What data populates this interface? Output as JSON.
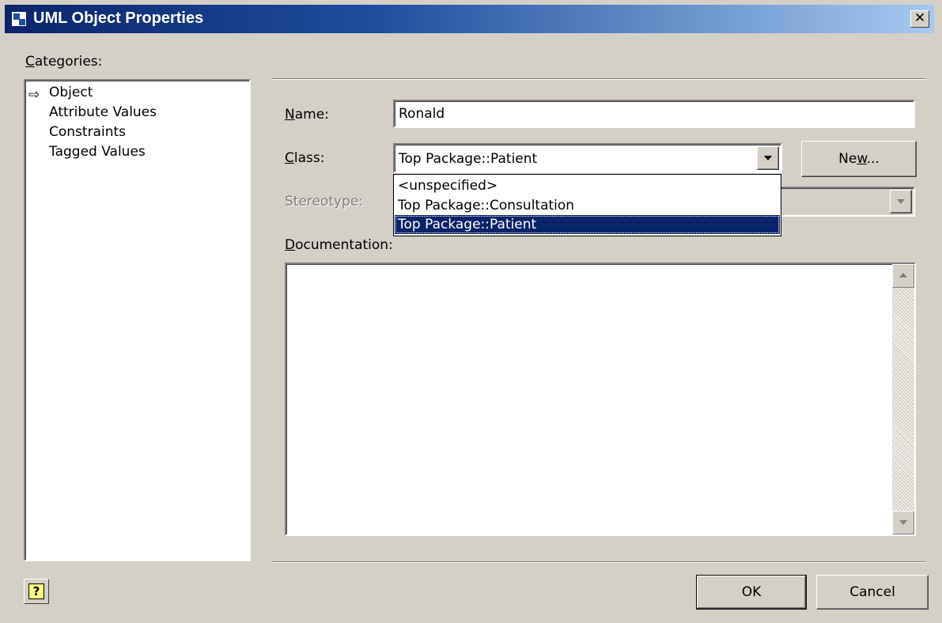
{
  "window": {
    "title": "UML Object Properties",
    "close_glyph": "✕"
  },
  "categories": {
    "label_first": "C",
    "label_rest": "ategories:",
    "arrow_glyph": "⇨",
    "items": [
      "Object",
      "Attribute Values",
      "Constraints",
      "Tagged Values"
    ]
  },
  "form": {
    "name_label_first": "N",
    "name_label_rest": "ame:",
    "name_value": "Ronald",
    "class_label_first": "C",
    "class_label_rest": "lass:",
    "class_value": "Top Package::Patient",
    "class_options": [
      "<unspecified>",
      "Top Package::Consultation",
      "Top Package::Patient"
    ],
    "selected_option": "Top Package::Patient",
    "new_button_pre": "Ne",
    "new_button_u": "w",
    "new_button_post": "...",
    "stereotype_label": "Stereotype:",
    "doc_label_first": "D",
    "doc_label_rest": "ocumentation:",
    "doc_value": ""
  },
  "buttons": {
    "help": "?",
    "ok": "OK",
    "cancel": "Cancel"
  }
}
